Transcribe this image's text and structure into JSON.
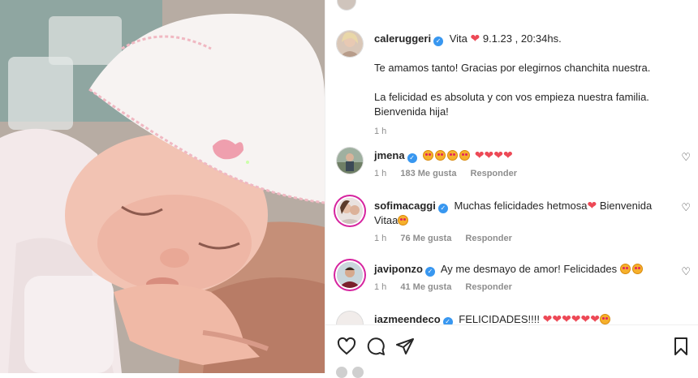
{
  "caption": {
    "username": "caleruggeri",
    "intro": "Vita",
    "date_text": "9.1.23 , 20:34hs.",
    "paragraph1": "Te amamos tanto! Gracias por elegirnos chanchita nuestra.",
    "paragraph2": "La felicidad es absoluta y con vos empieza nuestra familia. Bienvenida hija!",
    "time": "1 h"
  },
  "comments": [
    {
      "username": "jmena",
      "text": "",
      "time": "1 h",
      "likes": "183 Me gusta",
      "reply": "Responder",
      "emoji_faces": 4,
      "hearts": 4
    },
    {
      "username": "sofimacaggi",
      "text_a": "Muchas felicidades hetmosa",
      "text_b": "Bienvenida Vitaa",
      "time": "1 h",
      "likes": "76 Me gusta",
      "reply": "Responder"
    },
    {
      "username": "javiponzo",
      "text": "Ay me desmayo de amor! Felicidades",
      "time": "1 h",
      "likes": "41 Me gusta",
      "reply": "Responder"
    },
    {
      "username": "iazmeendeco",
      "text": "FELICIDADES!!!!"
    }
  ],
  "icons": [
    "heart-icon",
    "comment-icon",
    "share-icon",
    "bookmark-icon",
    "verified-icon"
  ],
  "colors": {
    "verified": "#3897f0",
    "heart": "#ed4956",
    "story_ring": "#d6249f",
    "meta_text": "#8e8e8e"
  }
}
